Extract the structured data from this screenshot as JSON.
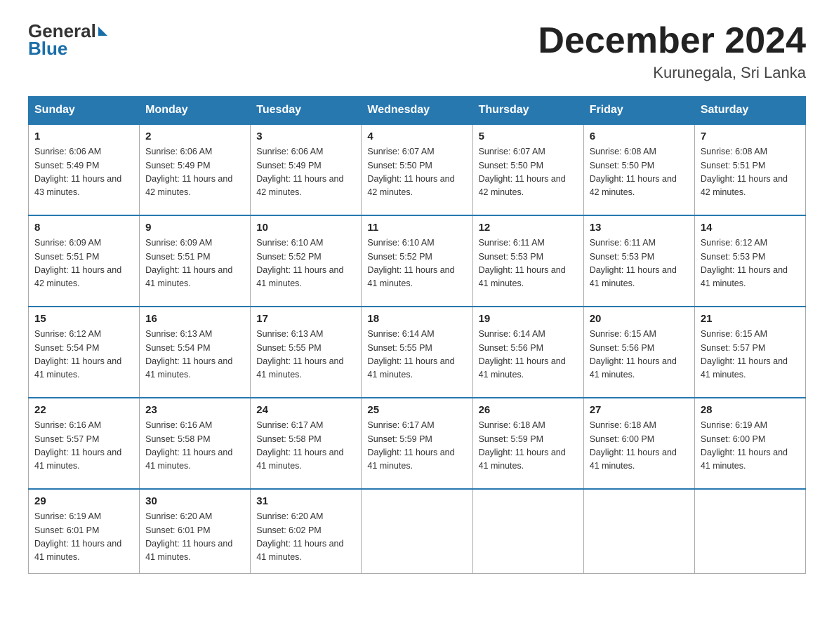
{
  "logo": {
    "line1": "General",
    "line2": "Blue"
  },
  "header": {
    "month": "December 2024",
    "location": "Kurunegala, Sri Lanka"
  },
  "days": [
    "Sunday",
    "Monday",
    "Tuesday",
    "Wednesday",
    "Thursday",
    "Friday",
    "Saturday"
  ],
  "weeks": [
    [
      {
        "day": "1",
        "sunrise": "6:06 AM",
        "sunset": "5:49 PM",
        "daylight": "11 hours and 43 minutes."
      },
      {
        "day": "2",
        "sunrise": "6:06 AM",
        "sunset": "5:49 PM",
        "daylight": "11 hours and 42 minutes."
      },
      {
        "day": "3",
        "sunrise": "6:06 AM",
        "sunset": "5:49 PM",
        "daylight": "11 hours and 42 minutes."
      },
      {
        "day": "4",
        "sunrise": "6:07 AM",
        "sunset": "5:50 PM",
        "daylight": "11 hours and 42 minutes."
      },
      {
        "day": "5",
        "sunrise": "6:07 AM",
        "sunset": "5:50 PM",
        "daylight": "11 hours and 42 minutes."
      },
      {
        "day": "6",
        "sunrise": "6:08 AM",
        "sunset": "5:50 PM",
        "daylight": "11 hours and 42 minutes."
      },
      {
        "day": "7",
        "sunrise": "6:08 AM",
        "sunset": "5:51 PM",
        "daylight": "11 hours and 42 minutes."
      }
    ],
    [
      {
        "day": "8",
        "sunrise": "6:09 AM",
        "sunset": "5:51 PM",
        "daylight": "11 hours and 42 minutes."
      },
      {
        "day": "9",
        "sunrise": "6:09 AM",
        "sunset": "5:51 PM",
        "daylight": "11 hours and 41 minutes."
      },
      {
        "day": "10",
        "sunrise": "6:10 AM",
        "sunset": "5:52 PM",
        "daylight": "11 hours and 41 minutes."
      },
      {
        "day": "11",
        "sunrise": "6:10 AM",
        "sunset": "5:52 PM",
        "daylight": "11 hours and 41 minutes."
      },
      {
        "day": "12",
        "sunrise": "6:11 AM",
        "sunset": "5:53 PM",
        "daylight": "11 hours and 41 minutes."
      },
      {
        "day": "13",
        "sunrise": "6:11 AM",
        "sunset": "5:53 PM",
        "daylight": "11 hours and 41 minutes."
      },
      {
        "day": "14",
        "sunrise": "6:12 AM",
        "sunset": "5:53 PM",
        "daylight": "11 hours and 41 minutes."
      }
    ],
    [
      {
        "day": "15",
        "sunrise": "6:12 AM",
        "sunset": "5:54 PM",
        "daylight": "11 hours and 41 minutes."
      },
      {
        "day": "16",
        "sunrise": "6:13 AM",
        "sunset": "5:54 PM",
        "daylight": "11 hours and 41 minutes."
      },
      {
        "day": "17",
        "sunrise": "6:13 AM",
        "sunset": "5:55 PM",
        "daylight": "11 hours and 41 minutes."
      },
      {
        "day": "18",
        "sunrise": "6:14 AM",
        "sunset": "5:55 PM",
        "daylight": "11 hours and 41 minutes."
      },
      {
        "day": "19",
        "sunrise": "6:14 AM",
        "sunset": "5:56 PM",
        "daylight": "11 hours and 41 minutes."
      },
      {
        "day": "20",
        "sunrise": "6:15 AM",
        "sunset": "5:56 PM",
        "daylight": "11 hours and 41 minutes."
      },
      {
        "day": "21",
        "sunrise": "6:15 AM",
        "sunset": "5:57 PM",
        "daylight": "11 hours and 41 minutes."
      }
    ],
    [
      {
        "day": "22",
        "sunrise": "6:16 AM",
        "sunset": "5:57 PM",
        "daylight": "11 hours and 41 minutes."
      },
      {
        "day": "23",
        "sunrise": "6:16 AM",
        "sunset": "5:58 PM",
        "daylight": "11 hours and 41 minutes."
      },
      {
        "day": "24",
        "sunrise": "6:17 AM",
        "sunset": "5:58 PM",
        "daylight": "11 hours and 41 minutes."
      },
      {
        "day": "25",
        "sunrise": "6:17 AM",
        "sunset": "5:59 PM",
        "daylight": "11 hours and 41 minutes."
      },
      {
        "day": "26",
        "sunrise": "6:18 AM",
        "sunset": "5:59 PM",
        "daylight": "11 hours and 41 minutes."
      },
      {
        "day": "27",
        "sunrise": "6:18 AM",
        "sunset": "6:00 PM",
        "daylight": "11 hours and 41 minutes."
      },
      {
        "day": "28",
        "sunrise": "6:19 AM",
        "sunset": "6:00 PM",
        "daylight": "11 hours and 41 minutes."
      }
    ],
    [
      {
        "day": "29",
        "sunrise": "6:19 AM",
        "sunset": "6:01 PM",
        "daylight": "11 hours and 41 minutes."
      },
      {
        "day": "30",
        "sunrise": "6:20 AM",
        "sunset": "6:01 PM",
        "daylight": "11 hours and 41 minutes."
      },
      {
        "day": "31",
        "sunrise": "6:20 AM",
        "sunset": "6:02 PM",
        "daylight": "11 hours and 41 minutes."
      },
      null,
      null,
      null,
      null
    ]
  ]
}
